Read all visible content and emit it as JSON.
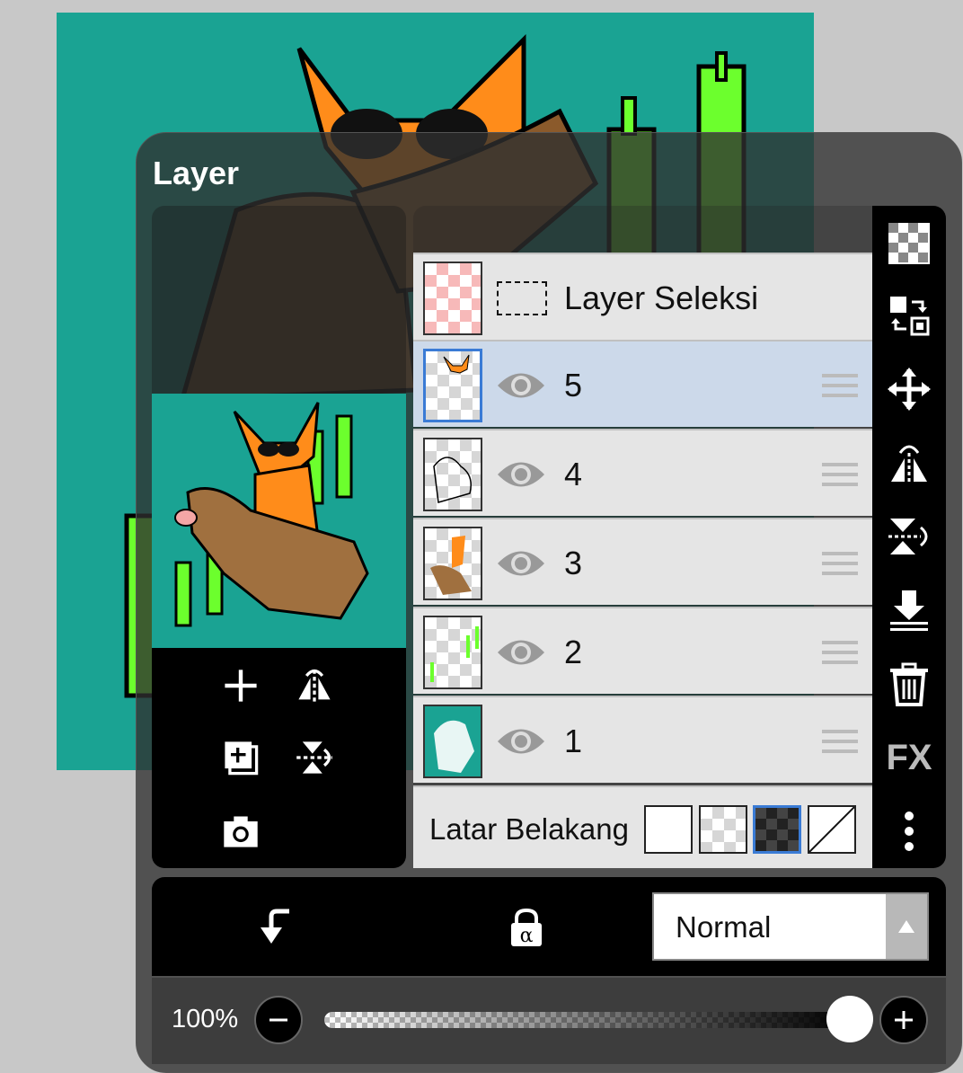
{
  "panel": {
    "title": "Layer"
  },
  "layers": [
    {
      "name": "Layer Seleksi",
      "kind": "selection"
    },
    {
      "name": "5",
      "selected": true,
      "visible": true
    },
    {
      "name": "4",
      "visible": true
    },
    {
      "name": "3",
      "visible": true
    },
    {
      "name": "2",
      "visible": true
    },
    {
      "name": "1",
      "visible": true
    }
  ],
  "background": {
    "label": "Latar Belakang",
    "options": [
      "white",
      "checker-light",
      "checker-dark",
      "none"
    ],
    "selected": "checker-dark"
  },
  "blend_mode": {
    "value": "Normal"
  },
  "opacity": {
    "label": "100%",
    "value": 100
  },
  "sidebar_icons": [
    "transparency-icon",
    "swap-icon",
    "move-icon",
    "flip-horizontal-icon",
    "flip-vertical-icon",
    "merge-down-icon",
    "delete-icon",
    "fx-icon",
    "more-icon"
  ],
  "sidebar": {
    "fx_label": "FX"
  },
  "preview_tools": [
    "add-layer-icon",
    "flip-horizontal-icon",
    "duplicate-layer-icon",
    "flip-vertical-icon",
    "camera-icon"
  ],
  "bottom_tools": [
    "clipping-icon",
    "alpha-lock-icon"
  ],
  "colors": {
    "canvas": "#1aa393",
    "accent": "#3a7bd5",
    "selected_row": "#ccd9ea",
    "candle": "#6cff2d"
  }
}
